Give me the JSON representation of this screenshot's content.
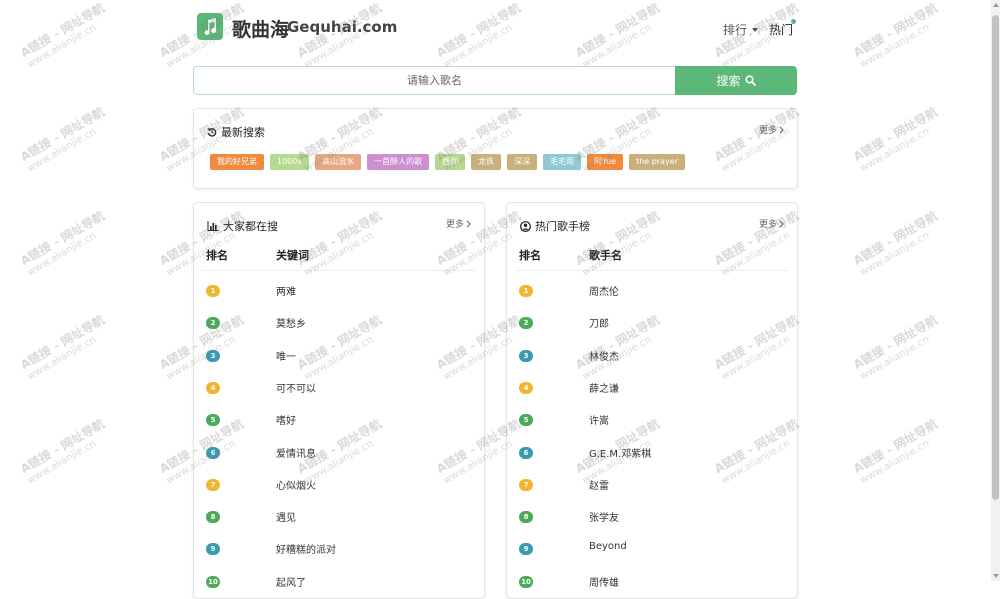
{
  "header": {
    "brand_cn": "歌曲海",
    "brand_en": "Gequhai.com",
    "nav_rank": "排行",
    "nav_hot": "热门"
  },
  "search": {
    "placeholder": "请输入歌名",
    "button_label": "搜索"
  },
  "recent": {
    "title": "最新搜索",
    "more": "更多",
    "tags": [
      {
        "label": "我的好兄弟",
        "color": "#f08a3e"
      },
      {
        "label": "1000x",
        "color": "#b5d98f"
      },
      {
        "label": "高山流水",
        "color": "#e4a882"
      },
      {
        "label": "一首醉人的歌",
        "color": "#cc8fd0"
      },
      {
        "label": "西湖",
        "color": "#b5d98f"
      },
      {
        "label": "龙族",
        "color": "#c9b07a"
      },
      {
        "label": "深深",
        "color": "#c9b07a"
      },
      {
        "label": "毛毛雨",
        "color": "#90c9d5"
      },
      {
        "label": "阿Yue",
        "color": "#f08a3e"
      },
      {
        "label": "the prayer",
        "color": "#c9b07a"
      }
    ]
  },
  "popular": {
    "title": "大家都在搜",
    "more": "更多",
    "col_rank": "排名",
    "col_keyword": "关键词",
    "rows": [
      {
        "rank": "1",
        "text": "两难"
      },
      {
        "rank": "2",
        "text": "莫愁乡"
      },
      {
        "rank": "3",
        "text": "唯一"
      },
      {
        "rank": "4",
        "text": "可不可以"
      },
      {
        "rank": "5",
        "text": "嗜好"
      },
      {
        "rank": "6",
        "text": "爱情讯息"
      },
      {
        "rank": "7",
        "text": "心似烟火"
      },
      {
        "rank": "8",
        "text": "遇见"
      },
      {
        "rank": "9",
        "text": "好糟糕的派对"
      },
      {
        "rank": "10",
        "text": "起风了"
      }
    ]
  },
  "singers": {
    "title": "热门歌手榜",
    "more": "更多",
    "col_rank": "排名",
    "col_name": "歌手名",
    "rows": [
      {
        "rank": "1",
        "text": "周杰伦"
      },
      {
        "rank": "2",
        "text": "刀郎"
      },
      {
        "rank": "3",
        "text": "林俊杰"
      },
      {
        "rank": "4",
        "text": "薛之谦"
      },
      {
        "rank": "5",
        "text": "许嵩"
      },
      {
        "rank": "6",
        "text": "G.E.M.邓紫棋"
      },
      {
        "rank": "7",
        "text": "赵雷"
      },
      {
        "rank": "8",
        "text": "张学友"
      },
      {
        "rank": "9",
        "text": "Beyond"
      },
      {
        "rank": "10",
        "text": "周传雄"
      }
    ]
  },
  "rank_colors": [
    "#f0b630",
    "#4caa5a",
    "#3a9ab0",
    "#f0b630",
    "#4caa5a",
    "#3a9ab0",
    "#f0b630",
    "#4caa5a",
    "#3a9ab0",
    "#4caa5a"
  ],
  "watermark": {
    "line1": "A链接 - 网址导航",
    "line2": "www.alianjie.cn"
  }
}
